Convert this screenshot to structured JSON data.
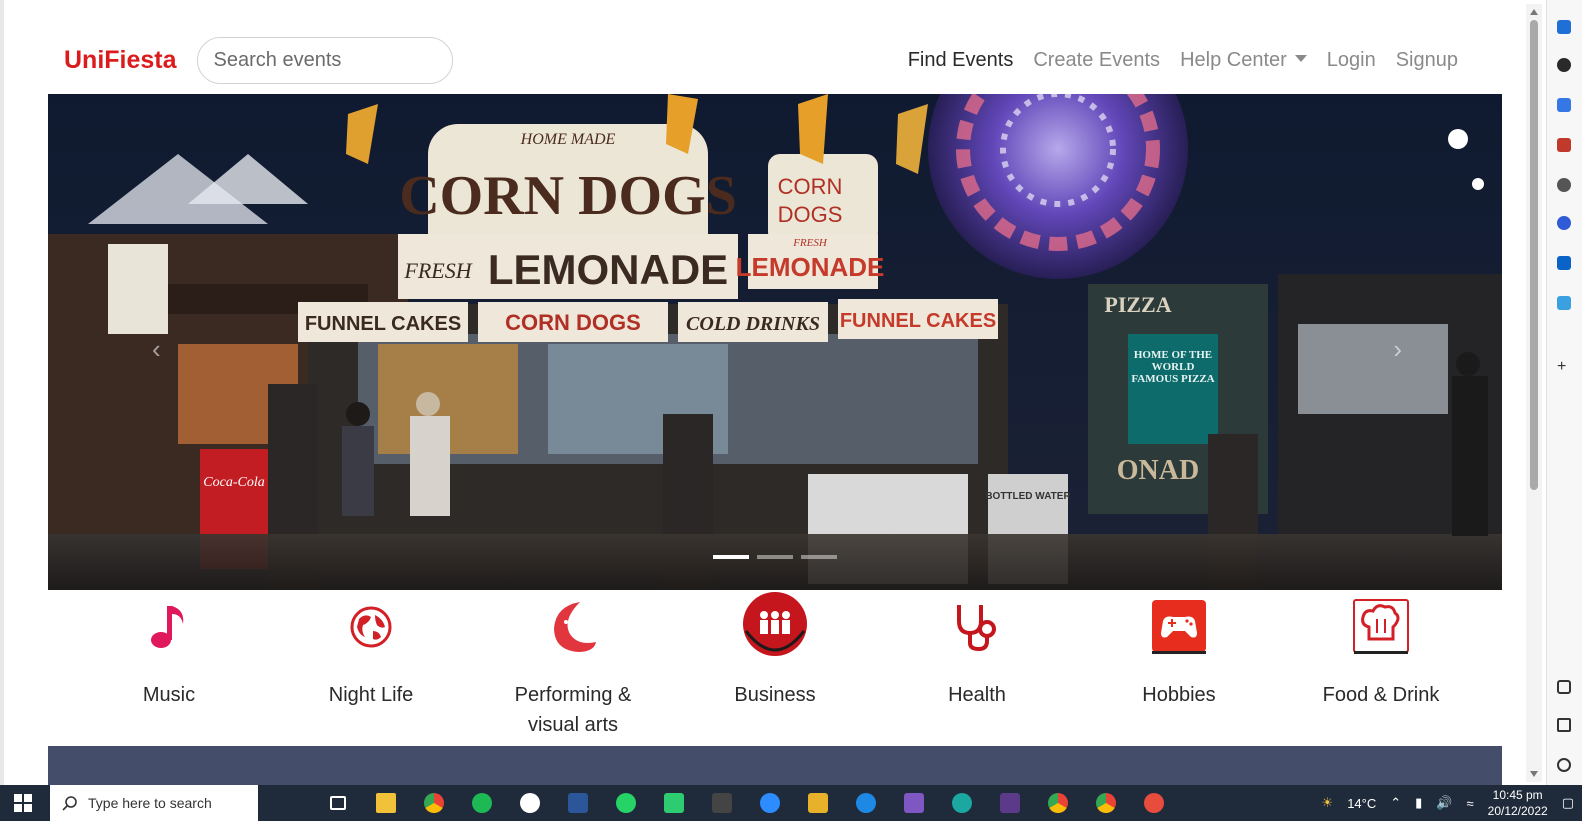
{
  "brand": "UniFiesta",
  "search": {
    "placeholder": "Search events"
  },
  "nav": {
    "find_events": "Find Events",
    "create_events": "Create Events",
    "help_center": "Help Center",
    "login": "Login",
    "signup": "Signup"
  },
  "carousel": {
    "signs": {
      "homemade": "HOME MADE",
      "corn_dogs_big": "CORN DOGS",
      "corn_small": "CORN",
      "dogs_small": "DOGS",
      "fresh": "FRESH",
      "lemonade": "LEMONADE",
      "fresh_small": "FRESH",
      "lemonade_small": "LEMONADE",
      "funnel_cakes": "FUNNEL CAKES",
      "corn_dogs": "CORN DOGS",
      "cold_drinks": "COLD DRINKS",
      "funnel_cakes_2": "FUNNEL CAKES",
      "pizza": "PIZZA",
      "home_of_pizza": "HOME OF THE WORLD FAMOUS PIZZA",
      "onad": "ONAD",
      "coca_cola": "Coca-Cola",
      "bottled_water": "BOTTLED WATER"
    },
    "slide_count": 3,
    "active_slide": 1
  },
  "categories": [
    {
      "label": "Music",
      "icon": "music-note-icon"
    },
    {
      "label": "Night Life",
      "icon": "globe-icon"
    },
    {
      "label": "Performing &",
      "label2": "visual arts",
      "icon": "moon-face-icon"
    },
    {
      "label": "Business",
      "icon": "people-icon"
    },
    {
      "label": "Health",
      "icon": "stethoscope-icon"
    },
    {
      "label": "Hobbies",
      "icon": "gamepad-icon"
    },
    {
      "label": "Food & Drink",
      "icon": "chef-hat-icon"
    }
  ],
  "taskbar": {
    "search_placeholder": "Type here to search",
    "temperature": "14°C",
    "time": "10:45 pm",
    "date": "20/12/2022"
  },
  "colors": {
    "brand_red": "#dc1c1c",
    "icon_red": "#d32027",
    "footer_bar": "#444e6a"
  }
}
